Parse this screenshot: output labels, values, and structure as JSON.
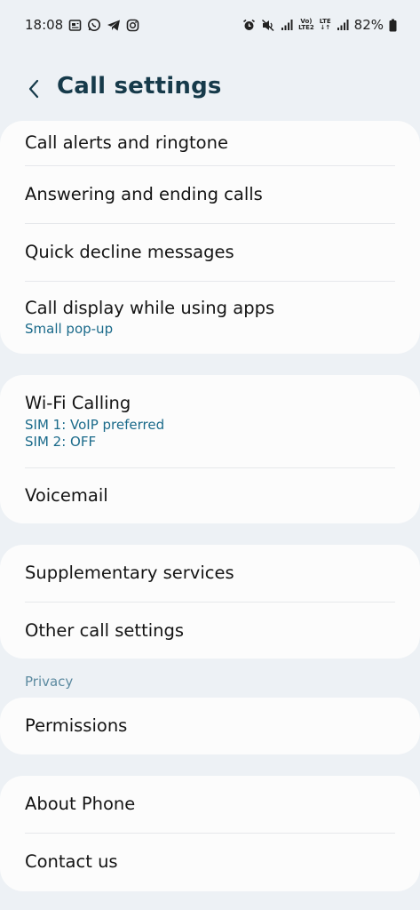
{
  "status_bar": {
    "time": "18:08",
    "volte_top": "Vo)",
    "volte_bottom": "LTE2",
    "lte_top": "LTE",
    "lte_bottom": "↓↑",
    "battery": "82%"
  },
  "header": {
    "title": "Call settings"
  },
  "groups": {
    "group1": [
      {
        "title": "Call alerts and ringtone"
      },
      {
        "title": "Answering and ending calls"
      },
      {
        "title": "Quick decline messages"
      },
      {
        "title": "Call display while using apps",
        "subtitle": "Small pop-up"
      }
    ],
    "group2": [
      {
        "title": "Wi-Fi Calling",
        "subtitle1": "SIM 1: VoIP preferred",
        "subtitle2": "SIM 2: OFF"
      },
      {
        "title": "Voicemail"
      }
    ],
    "group3": [
      {
        "title": "Supplementary services"
      },
      {
        "title": "Other call settings"
      }
    ],
    "privacy_label": "Privacy",
    "group4": [
      {
        "title": "Permissions"
      }
    ],
    "group5": [
      {
        "title": "About Phone"
      },
      {
        "title": "Contact us"
      }
    ]
  },
  "colors": {
    "background": "#edf1f5",
    "card": "#fcfcfc",
    "title": "#163a4a",
    "subtitle": "#1a6a8a",
    "section_label": "#5c8aa0"
  }
}
